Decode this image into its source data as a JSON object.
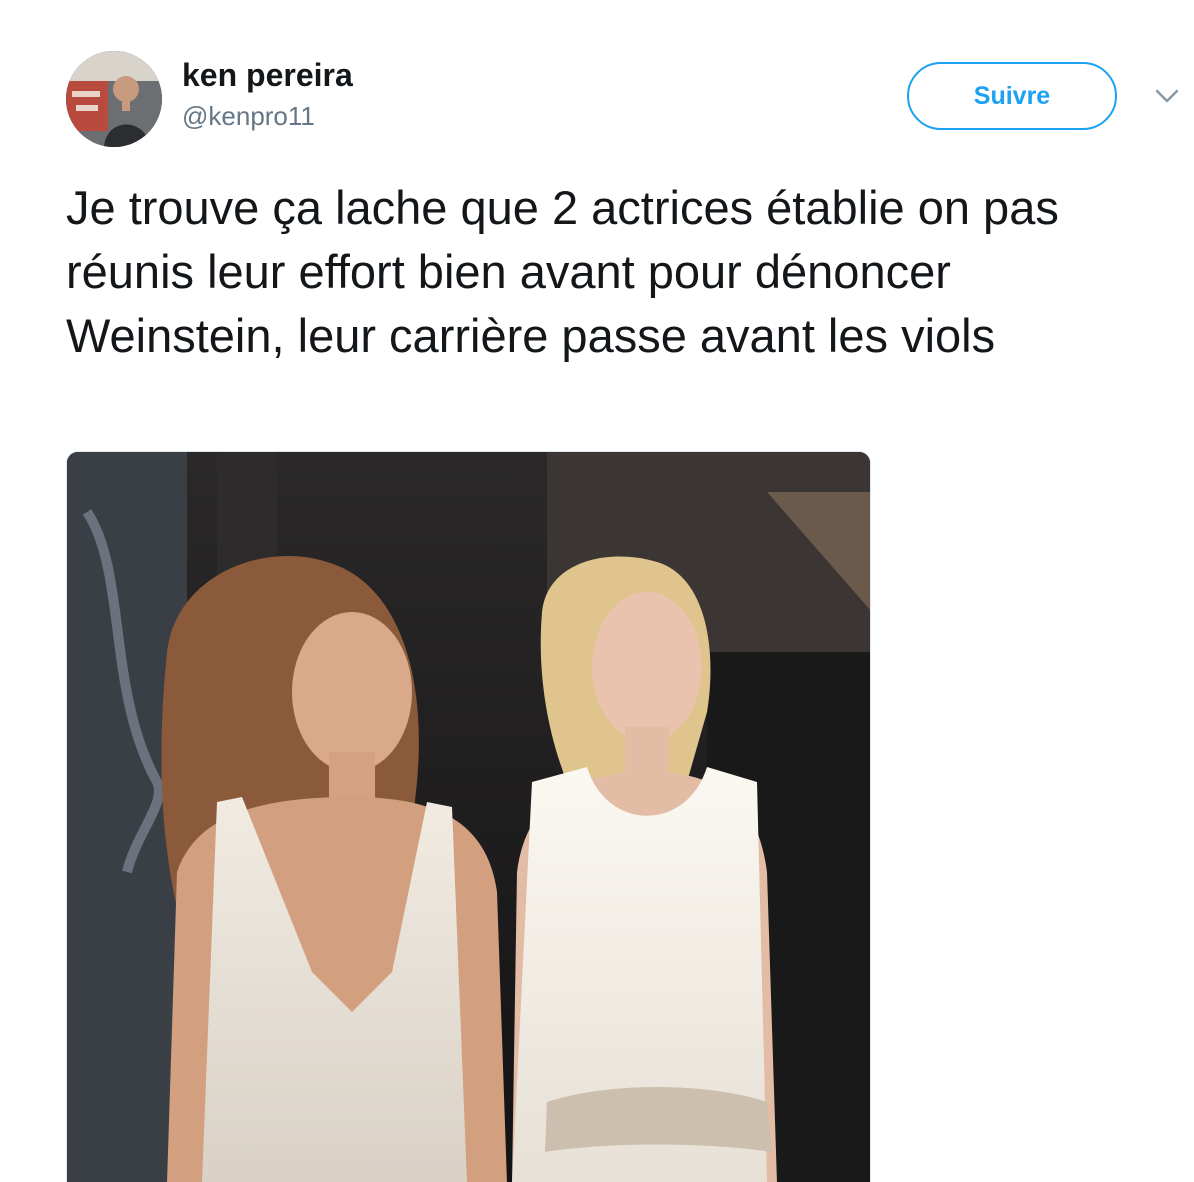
{
  "tweet": {
    "author": {
      "display_name": "ken pereira",
      "handle": "@kenpro11"
    },
    "follow_label": "Suivre",
    "text": "Je trouve ça lache que 2 actrices établie on pas réunis leur effort bien avant pour dénoncer Weinstein, leur carrière passe avant les viols",
    "media_icon": "photo",
    "menu_icon": "chevron-down-icon"
  },
  "colors": {
    "accent": "#1da1f2",
    "text": "#14171a",
    "secondary_text": "#657786"
  }
}
